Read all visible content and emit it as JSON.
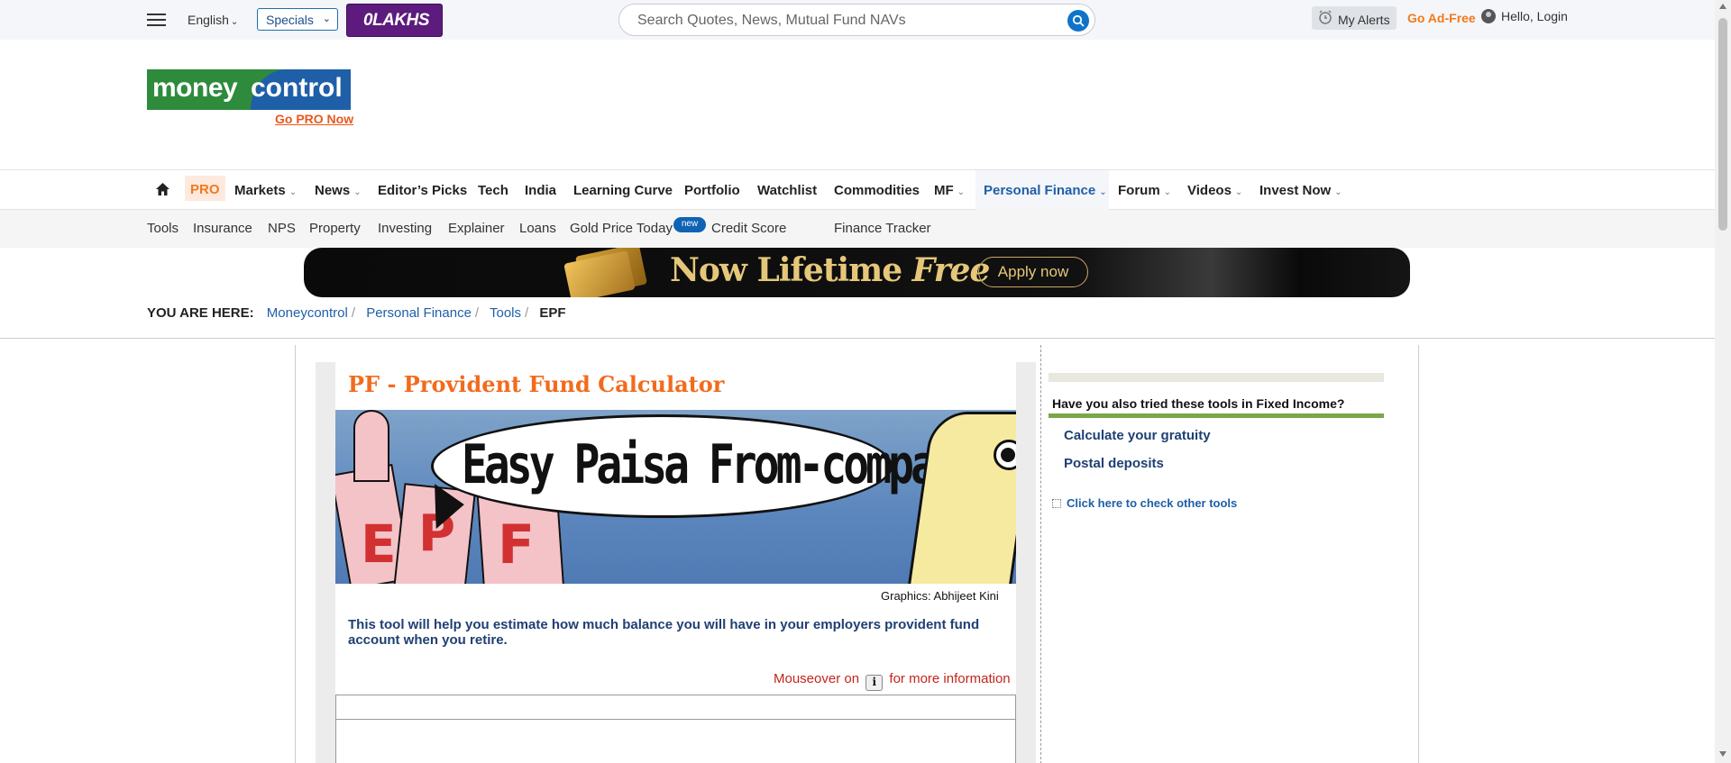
{
  "topbar": {
    "language": "English",
    "specials": "Specials",
    "olakhs_brand": "0LAKHS",
    "search_placeholder": "Search Quotes, News, Mutual Fund NAVs",
    "my_alerts": "My Alerts",
    "go_ad_free": "Go Ad-Free",
    "login": "Hello, Login"
  },
  "logo": {
    "text_a": "money",
    "text_b": "control",
    "go_pro": "Go PRO Now"
  },
  "nav": {
    "pro": "PRO",
    "items": [
      "Markets",
      "News",
      "Editor’s Picks",
      "Tech",
      "India",
      "Learning Curve",
      "Portfolio",
      "Watchlist",
      "Commodities",
      "MF",
      "Personal Finance",
      "Forum",
      "Videos",
      "Invest Now"
    ]
  },
  "subnav": {
    "items": [
      "Tools",
      "Insurance",
      "NPS",
      "Property",
      "Investing",
      "Explainer",
      "Loans",
      "Gold Price Today",
      "Credit Score",
      "Finance Tracker"
    ],
    "new_badge": "new"
  },
  "banner": {
    "headline_a": "Now Lifetime ",
    "headline_b": "Free",
    "apply": "Apply now"
  },
  "breadcrumb": {
    "label": "YOU ARE HERE:",
    "links": [
      "Moneycontrol",
      "Personal Finance",
      "Tools"
    ],
    "current": "EPF",
    "separator": "/"
  },
  "content": {
    "title": "PF - Provident Fund Calculator",
    "hero_text": "Easy Paisa From-company!",
    "hero_letters": [
      "E",
      "P",
      "F"
    ],
    "credit": "Graphics: Abhijeet Kini",
    "description": "This tool will help you estimate how much balance you will have in your employers provident fund account when you retire.",
    "mouseover_a": "Mouseover on",
    "info_icon": "i",
    "mouseover_b": "for more information"
  },
  "sidebar": {
    "heading": "Have you also tried these tools in Fixed Income?",
    "links": [
      "Calculate your gratuity",
      "Postal deposits"
    ],
    "other_tools": "Click here to check other tools"
  }
}
